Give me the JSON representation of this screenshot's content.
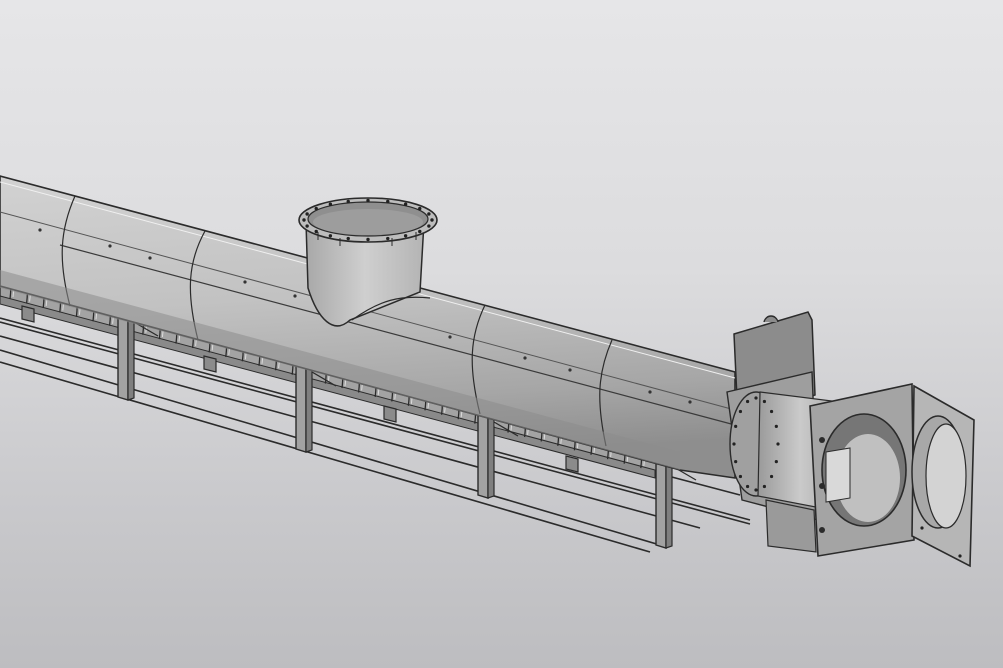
{
  "scene": {
    "subject": "screw-conveyor-3d-model",
    "colors": {
      "background_top": "#e6e6e8",
      "background_bottom": "#bdbdc0",
      "metal_light": "#c4c4c4",
      "metal_mid": "#a9a9a9",
      "metal_dark": "#7c7c7c",
      "edge": "#2b2b2b"
    },
    "components": [
      "conveyor-trough",
      "cylindrical-cover",
      "inlet-nozzle",
      "trough-ribs",
      "support-legs",
      "support-frame-rails",
      "outlet-flange",
      "end-plate",
      "hinged-inspection-door"
    ]
  }
}
